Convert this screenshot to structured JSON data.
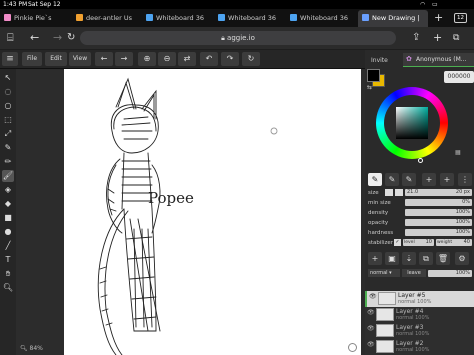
{
  "status": {
    "time": "1:43 PM",
    "date": "Sat Sep 12"
  },
  "tabs": [
    {
      "title": "Pinkie Pie`s",
      "color": "#f18cc8"
    },
    {
      "title": "deer-antler Us",
      "color": "#f0a030"
    },
    {
      "title": "Whiteboard 36",
      "color": "#4da3f0"
    },
    {
      "title": "Whiteboard 36",
      "color": "#4da3f0"
    },
    {
      "title": "Whiteboard 36",
      "color": "#4da3f0"
    },
    {
      "title": "New Drawing |",
      "color": "#6aa0ff"
    }
  ],
  "tab_count": "12",
  "address": {
    "url": "aggie.io"
  },
  "menu": {
    "file": "File",
    "edit": "Edit",
    "view": "View"
  },
  "toolbar_icons": [
    "arrow-left-icon",
    "arrow-right-icon",
    "zoom-in-icon",
    "zoom-out-icon",
    "swap-icon",
    "fit-icon",
    "undo-icon",
    "redo-icon",
    "rotate-icon"
  ],
  "user": {
    "invite": "Invite",
    "name": "Anonymous (M..."
  },
  "color": {
    "hex": "000000",
    "primary": "#000000",
    "secondary": "#e8b800"
  },
  "brush": {
    "size_label": "size",
    "size_val": "21.0",
    "size_px": "20 px",
    "min_size_label": "min size",
    "min_size_val": "0%",
    "density_label": "density",
    "density_val": "100%",
    "opacity_label": "opacity",
    "opacity_val": "100%",
    "hardness_label": "hardness",
    "hardness_val": "100%",
    "stabilizer_label": "stabilizer",
    "level_label": "level",
    "level_val": "10",
    "weight_label": "weight",
    "weight_val": "40"
  },
  "layers_header": {
    "blend": "normal",
    "leave": "leave",
    "opacity": "100%"
  },
  "layers": [
    {
      "name": "Layer #5",
      "mode": "normal 100%"
    },
    {
      "name": "Layer #4",
      "mode": "normal 100%"
    },
    {
      "name": "Layer #3",
      "mode": "normal 100%"
    },
    {
      "name": "Layer #2",
      "mode": "normal 100%"
    }
  ],
  "canvas": {
    "zoom": "84%",
    "text": "Popee"
  }
}
